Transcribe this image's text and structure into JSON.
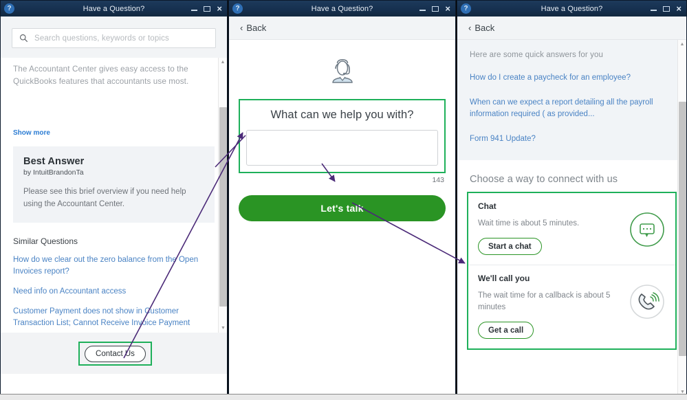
{
  "window": {
    "title": "Have a Question?",
    "help_icon": "?",
    "minimize": "minimize-icon",
    "maximize": "maximize-icon",
    "close": "×"
  },
  "panel1": {
    "search": {
      "placeholder": "Search questions, keywords or topics",
      "icon": "search-icon"
    },
    "article_text": "The Accountant Center gives easy access to the QuickBooks features that accountants use most.",
    "show_more": "Show more",
    "best_answer": {
      "title": "Best Answer",
      "by": "by IntuitBrandonTa",
      "body": "Please see this brief overview if you need help using the Accountant Center."
    },
    "similar_heading": "Similar Questions",
    "similar_questions": [
      "How do we clear out the zero balance from the Open Invoices report?",
      "Need info on Accountant access",
      "Customer Payment does not show in Customer Transaction List; Cannot Receive Invoice Payment"
    ],
    "contact_button": "Contact Us"
  },
  "panel2": {
    "back": "Back",
    "back_chevron": "‹",
    "agent_icon": "headset-agent-icon",
    "question_title": "What can we help you with?",
    "textarea_value": "",
    "char_count": "143",
    "talk_button": "Let's talk"
  },
  "panel3": {
    "back": "Back",
    "back_chevron": "‹",
    "quick_answers_intro": "Here are some quick answers for you",
    "quick_answers": [
      "How do I create a paycheck for an employee?",
      "When can we expect a report detailing all the payroll information required ( as provided...",
      "Form 941 Update?"
    ],
    "connect_heading": "Choose a way to connect with us",
    "options": [
      {
        "title": "Chat",
        "subtitle": "Wait time is about 5 minutes.",
        "button": "Start a chat",
        "icon": "chat-bubble-icon"
      },
      {
        "title": "We'll call you",
        "subtitle": "The wait time for a callback is about 5 minutes",
        "button": "Get a call",
        "icon": "phone-ringing-icon"
      }
    ]
  },
  "colors": {
    "titlebar": "#16304f",
    "highlight_green": "#1eb05a",
    "button_green": "#2a9424",
    "link_blue": "#4a83c4",
    "arrow_purple": "#4b2a78"
  }
}
